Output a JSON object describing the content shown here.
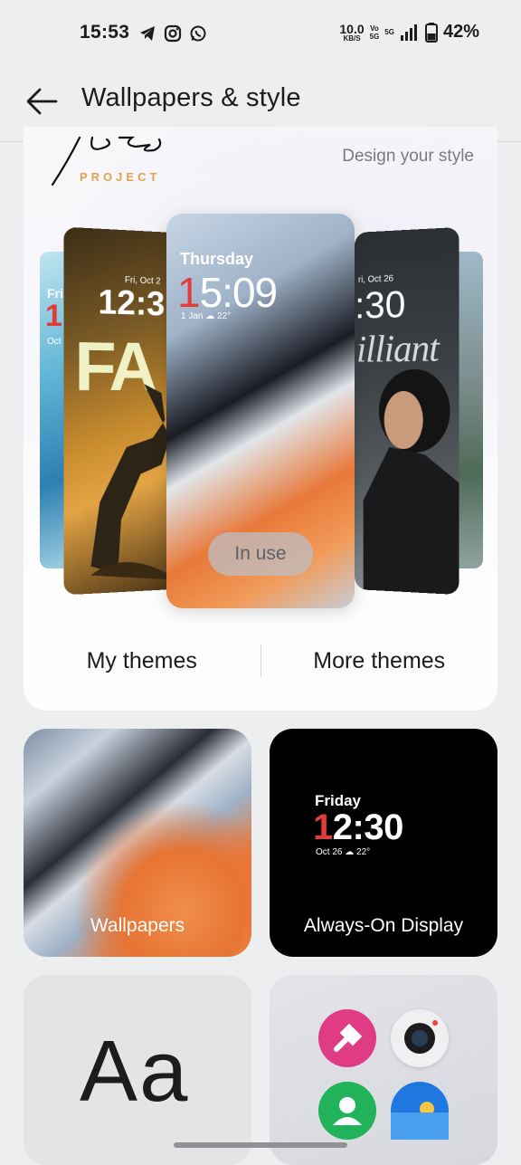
{
  "status_bar": {
    "time": "15:53",
    "net_speed": "10.0",
    "net_unit": "KB/S",
    "vo_top": "Vo",
    "vo_bottom": "5G",
    "network_label": "5G",
    "battery": "42%",
    "icons": [
      "telegram-icon",
      "instagram-icon",
      "whatsapp-icon",
      "signal-icon",
      "battery-icon"
    ]
  },
  "header": {
    "title": "Wallpapers & style"
  },
  "hero": {
    "logo_text": "PROJECT",
    "tagline": "Design your style",
    "center_card": {
      "day": "Thursday",
      "time_accent": "1",
      "time_rest": "5:09",
      "meta": "1 Jan  ☁ 22°",
      "badge": "In use"
    },
    "left_card": {
      "date": "Fri, Oct 2",
      "time": "12:3",
      "word": "FA"
    },
    "far_left_card": {
      "date": "Fri",
      "time": "1",
      "meta": "Oct"
    },
    "right_card": {
      "date": "ri, Oct 26",
      "time": ":30",
      "word": "illiant"
    },
    "tabs": [
      "My themes",
      "More themes"
    ]
  },
  "tiles": {
    "wallpapers": {
      "label": "Wallpapers"
    },
    "aod": {
      "label": "Always-On Display",
      "day": "Friday",
      "time_accent": "1",
      "time_rest": "2:30",
      "meta": "Oct 26  ☁ 22°"
    },
    "fonts": {
      "sample": "Aa"
    },
    "icons": {
      "apps": [
        "paint-app-icon",
        "camera-app-icon",
        "contacts-app-icon",
        "weather-app-icon"
      ],
      "colors": {
        "paint": "#e03c86",
        "camera": "#f0f0f2",
        "contacts": "#22b35a",
        "weather": "#1f78e0"
      }
    }
  }
}
